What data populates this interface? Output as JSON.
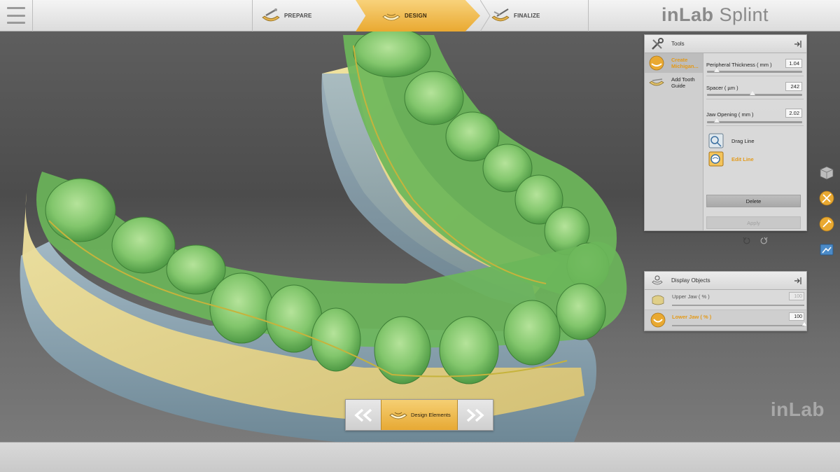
{
  "app": {
    "brand_bold": "inLab",
    "brand_rest": " Splint",
    "watermark": "inLab"
  },
  "topbar": {
    "steps": [
      {
        "label": "PREPARE"
      },
      {
        "label": "DESIGN"
      },
      {
        "label": "FINALIZE"
      }
    ]
  },
  "tools_panel": {
    "title": "Tools",
    "tools": [
      {
        "label": "Create Michigan...",
        "active": true
      },
      {
        "label": "Add Tooth Guide",
        "active": false
      }
    ],
    "params": [
      {
        "label": "Peripheral Thickness  ( mm )",
        "value": "1.04",
        "fraction": 0.1
      },
      {
        "label": "Spacer  ( µm )",
        "value": "242",
        "fraction": 0.48
      },
      {
        "label": "Jaw Opening  ( mm )",
        "value": "2.02",
        "fraction": 0.1
      }
    ],
    "line_tools": [
      {
        "label": "Drag Line",
        "active": false
      },
      {
        "label": "Edit Line",
        "active": true
      }
    ],
    "delete_label": "Delete",
    "apply_label": "Apply"
  },
  "display_panel": {
    "title": "Display Objects",
    "objects": [
      {
        "label": "Upper Jaw  ( % )",
        "value": "100",
        "active": false
      },
      {
        "label": "Lower Jaw  ( % )",
        "value": "100",
        "active": true
      }
    ]
  },
  "bottom_nav": {
    "label": "Design Elements"
  },
  "colors": {
    "accent": "#e9a931",
    "splint_green": "#7fc86a",
    "model_yellow": "#e9d98c",
    "model_blue": "#8fa9b8"
  }
}
